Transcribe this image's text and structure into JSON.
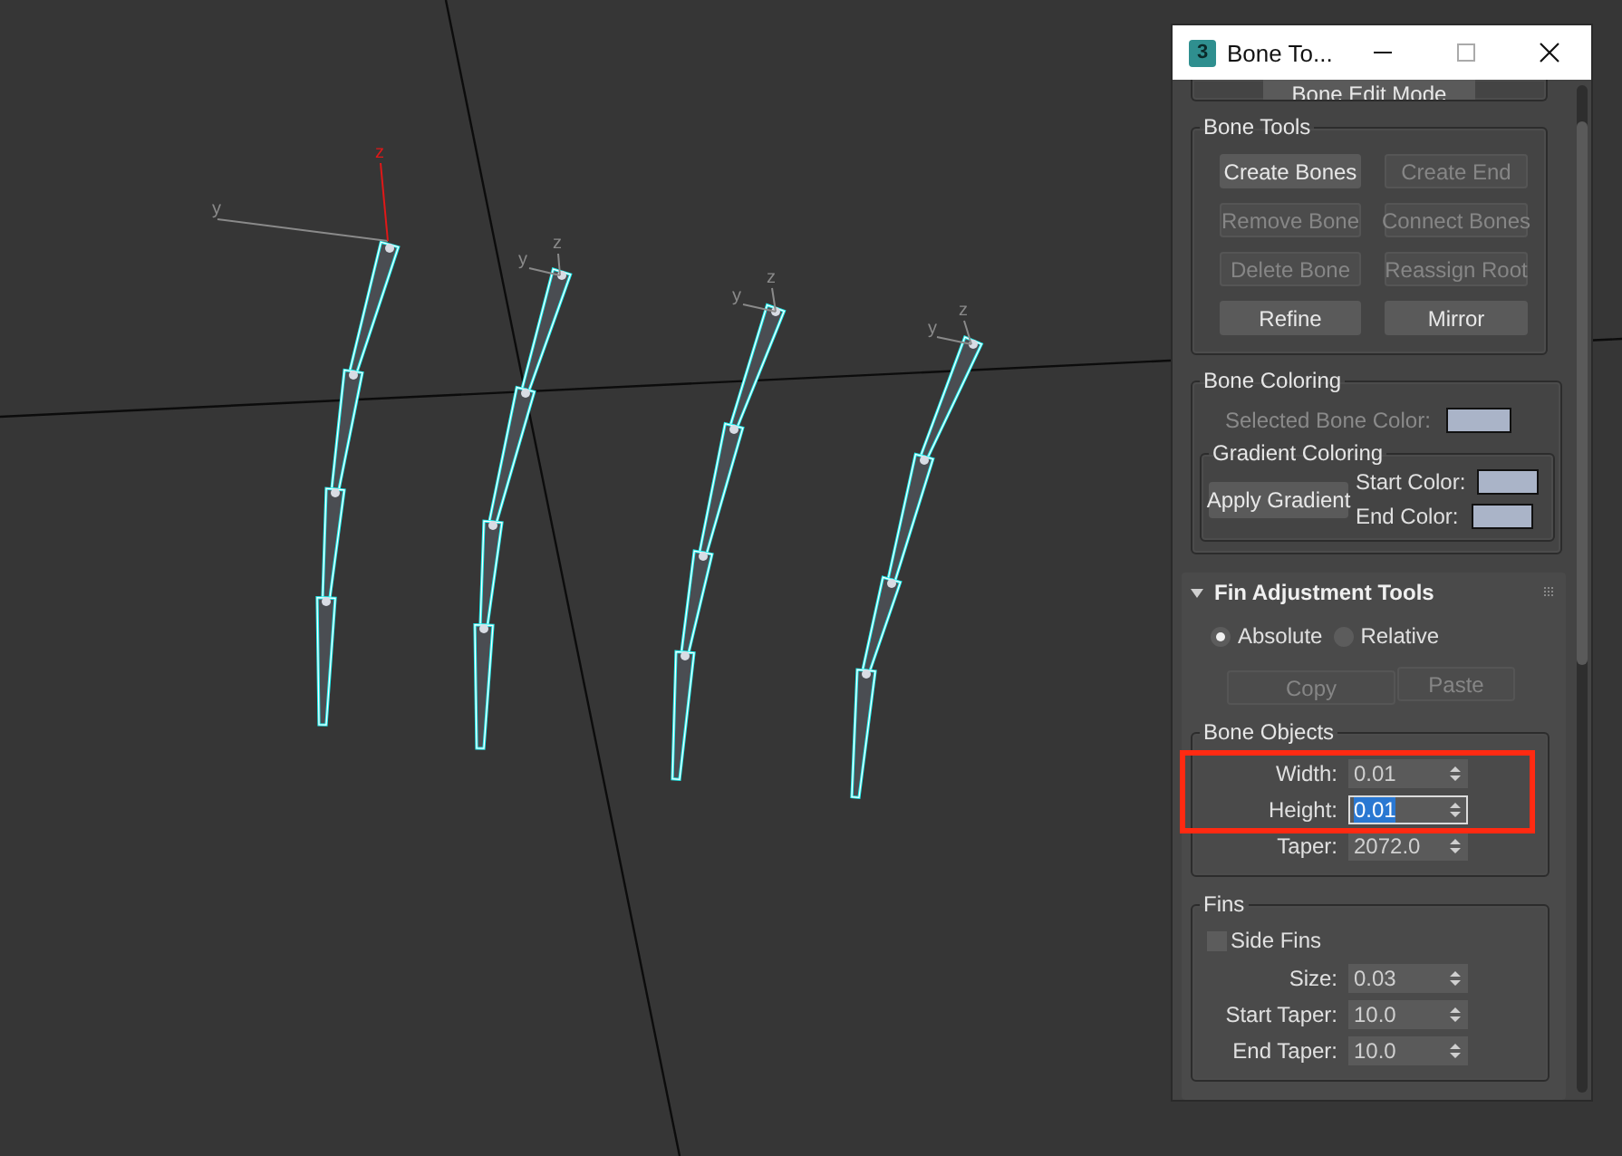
{
  "viewport": {
    "gizmos": [
      {
        "y_label": "y",
        "z_label": "z",
        "selected": true
      },
      {
        "y_label": "y",
        "z_label": "z",
        "selected": false
      },
      {
        "y_label": "y",
        "z_label": "z",
        "selected": false
      },
      {
        "y_label": "y",
        "z_label": "z",
        "selected": false
      }
    ]
  },
  "window": {
    "app_icon": "3",
    "title": "Bone To..."
  },
  "edit_mode_button": {
    "label": "Bone Edit Mode",
    "disabled": false
  },
  "bone_tools": {
    "title": "Bone Tools",
    "buttons": [
      {
        "label": "Create Bones",
        "disabled": false
      },
      {
        "label": "Create End",
        "disabled": true
      },
      {
        "label": "Remove Bone",
        "disabled": true
      },
      {
        "label": "Connect Bones",
        "disabled": true
      },
      {
        "label": "Delete Bone",
        "disabled": true
      },
      {
        "label": "Reassign Root",
        "disabled": true
      },
      {
        "label": "Refine",
        "disabled": false
      },
      {
        "label": "Mirror",
        "disabled": false
      }
    ]
  },
  "bone_coloring": {
    "title": "Bone Coloring",
    "selected_bone_color": {
      "label": "Selected Bone Color:",
      "disabled": true,
      "color": "#aab4c8"
    },
    "gradient": {
      "title": "Gradient Coloring",
      "button": "Apply Gradient",
      "start_color": {
        "label": "Start Color:",
        "color": "#aab4c8"
      },
      "end_color": {
        "label": "End Color:",
        "color": "#aab4c8"
      }
    }
  },
  "fin_adjustment": {
    "title": "Fin Adjustment Tools",
    "expanded": true,
    "radios": [
      {
        "label": "Absolute",
        "selected": true
      },
      {
        "label": "Relative",
        "selected": false
      }
    ],
    "buttons": [
      {
        "label": "Copy",
        "disabled": true
      },
      {
        "label": "Paste",
        "disabled": true
      }
    ],
    "bone_objects": {
      "title": "Bone Objects",
      "fields": [
        {
          "label": "Width:",
          "value": "0.01",
          "focused": false,
          "highlighted": true
        },
        {
          "label": "Height:",
          "value": "0.01",
          "focused": true,
          "highlighted": true
        },
        {
          "label": "Taper:",
          "value": "2072.0",
          "focused": false,
          "highlighted": false
        }
      ]
    },
    "fins": {
      "title": "Fins",
      "side_fins": {
        "label": "Side Fins",
        "checked": false
      },
      "fields": [
        {
          "label": "Size:",
          "value": "0.03",
          "focused": false,
          "highlighted": false
        },
        {
          "label": "Start Taper:",
          "value": "10.0",
          "focused": false,
          "highlighted": false
        },
        {
          "label": "End Taper:",
          "value": "10.0",
          "focused": false,
          "highlighted": false
        }
      ]
    }
  }
}
